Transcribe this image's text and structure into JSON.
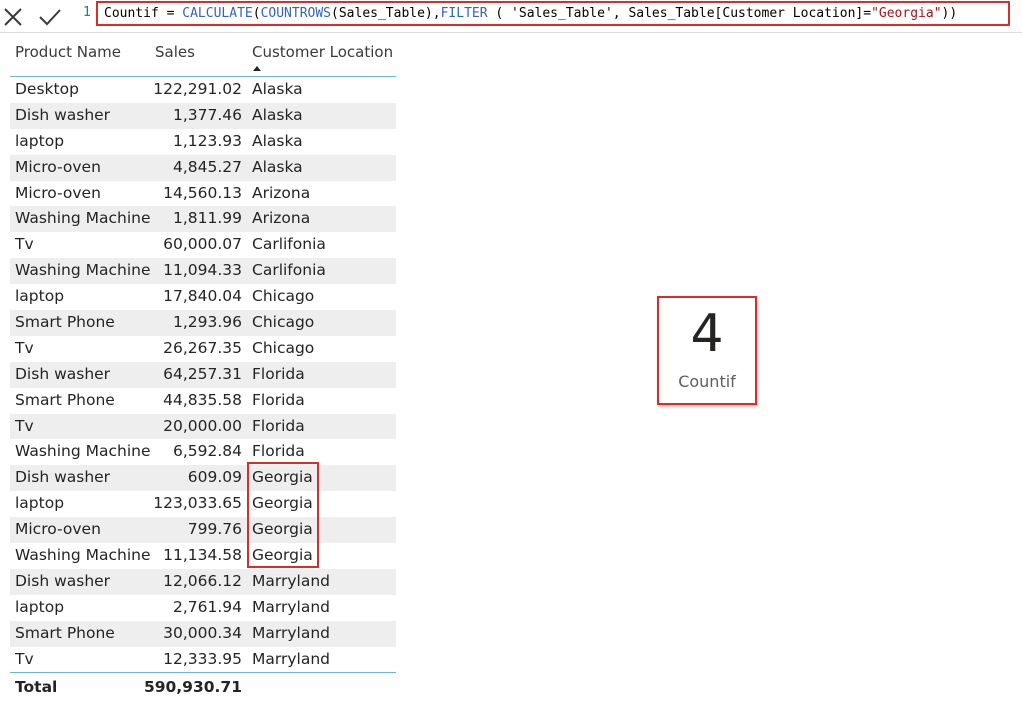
{
  "formula_bar": {
    "line_number": "1",
    "formula_parts": [
      {
        "text": "Countif = ",
        "kind": "plain"
      },
      {
        "text": "CALCULATE",
        "kind": "kw"
      },
      {
        "text": "(",
        "kind": "plain"
      },
      {
        "text": "COUNTROWS",
        "kind": "kw"
      },
      {
        "text": "(Sales_Table),",
        "kind": "plain"
      },
      {
        "text": "FILTER",
        "kind": "kw"
      },
      {
        "text": " ( 'Sales_Table', Sales_Table[Customer Location]=",
        "kind": "plain"
      },
      {
        "text": "\"Georgia\"",
        "kind": "str"
      },
      {
        "text": "))",
        "kind": "plain"
      }
    ],
    "highlight_color": "#d32f2f"
  },
  "table": {
    "headers": {
      "product": "Product Name",
      "sales": "Sales",
      "location": "Customer Location"
    },
    "sorted_column": "location",
    "rows": [
      {
        "product": "Desktop",
        "sales": "122,291.02",
        "location": "Alaska"
      },
      {
        "product": "Dish washer",
        "sales": "1,377.46",
        "location": "Alaska"
      },
      {
        "product": "laptop",
        "sales": "1,123.93",
        "location": "Alaska"
      },
      {
        "product": "Micro-oven",
        "sales": "4,845.27",
        "location": "Alaska"
      },
      {
        "product": "Micro-oven",
        "sales": "14,560.13",
        "location": "Arizona"
      },
      {
        "product": "Washing Machine",
        "sales": "1,811.99",
        "location": "Arizona"
      },
      {
        "product": "Tv",
        "sales": "60,000.07",
        "location": "Carlifonia"
      },
      {
        "product": "Washing Machine",
        "sales": "11,094.33",
        "location": "Carlifonia"
      },
      {
        "product": "laptop",
        "sales": "17,840.04",
        "location": "Chicago"
      },
      {
        "product": "Smart Phone",
        "sales": "1,293.96",
        "location": "Chicago"
      },
      {
        "product": "Tv",
        "sales": "26,267.35",
        "location": "Chicago"
      },
      {
        "product": "Dish washer",
        "sales": "64,257.31",
        "location": "Florida"
      },
      {
        "product": "Smart Phone",
        "sales": "44,835.58",
        "location": "Florida"
      },
      {
        "product": "Tv",
        "sales": "20,000.00",
        "location": "Florida"
      },
      {
        "product": "Washing Machine",
        "sales": "6,592.84",
        "location": "Florida"
      },
      {
        "product": "Dish washer",
        "sales": "609.09",
        "location": "Georgia"
      },
      {
        "product": "laptop",
        "sales": "123,033.65",
        "location": "Georgia"
      },
      {
        "product": "Micro-oven",
        "sales": "799.76",
        "location": "Georgia"
      },
      {
        "product": "Washing Machine",
        "sales": "11,134.58",
        "location": "Georgia"
      },
      {
        "product": "Dish washer",
        "sales": "12,066.12",
        "location": "Marryland"
      },
      {
        "product": "laptop",
        "sales": "2,761.94",
        "location": "Marryland"
      },
      {
        "product": "Smart Phone",
        "sales": "30,000.34",
        "location": "Marryland"
      },
      {
        "product": "Tv",
        "sales": "12,333.95",
        "location": "Marryland"
      }
    ],
    "total": {
      "label": "Total",
      "sales": "590,930.71"
    },
    "highlighted_location": "Georgia"
  },
  "card": {
    "value": "4",
    "label": "Countif"
  }
}
